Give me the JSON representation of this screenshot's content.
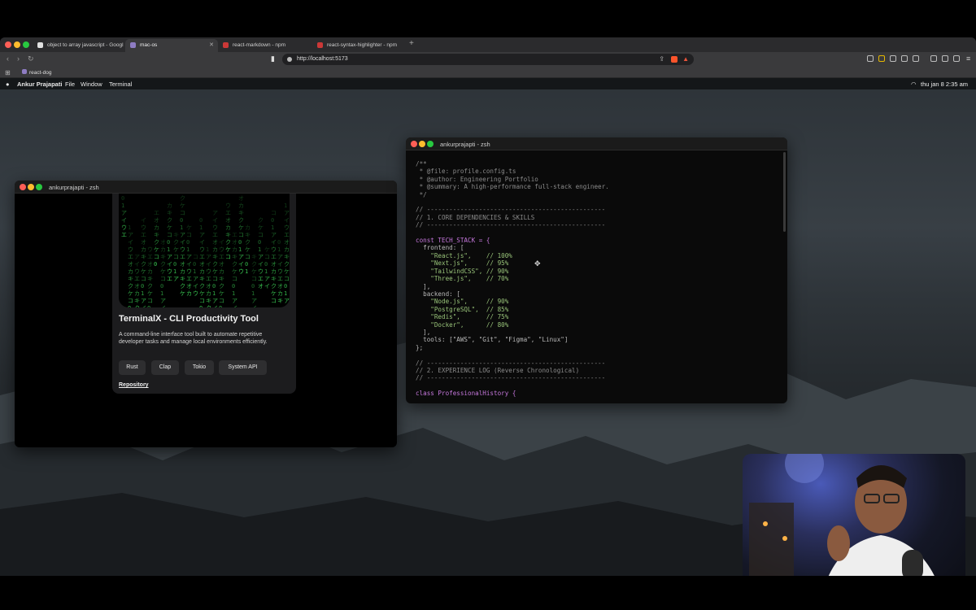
{
  "browser": {
    "tabs": [
      {
        "label": "object to array javascript - Googl",
        "active": false
      },
      {
        "label": "mac-os",
        "active": true
      },
      {
        "label": "react-markdown - npm",
        "active": false
      },
      {
        "label": "react-syntax-highlighter - npm",
        "active": false
      }
    ],
    "new_tab": "+",
    "url": "http://localhost:5173",
    "bookmark": "react-dog"
  },
  "menubar": {
    "apple": "",
    "user": "Ankur Prajapati",
    "items": [
      "File",
      "Window",
      "Terminal"
    ],
    "clock": "thu jan 8 2:35 am"
  },
  "left_window": {
    "title": "ankurprajapti - zsh",
    "card": {
      "title": "TerminalX - CLI Productivity Tool",
      "description": "A command-line interface tool built to automate repetitive developer tasks and manage local environments efficiently.",
      "tags": [
        "Rust",
        "Clap",
        "Tokio",
        "System API"
      ],
      "link": "Repository"
    }
  },
  "right_window": {
    "title": "ankurprajapti - zsh",
    "code": [
      "/**",
      " * @file: profile.config.ts",
      " * @author: Engineering Portfolio",
      " * @summary: A high-performance full-stack engineer.",
      " */",
      "",
      "// ------------------------------------------------",
      "// 1. CORE DEPENDENCIES & SKILLS",
      "// ------------------------------------------------",
      "",
      "const TECH_STACK = {",
      "  frontend: [",
      "    \"React.js\",    // 100%",
      "    \"Next.js\",     // 95%",
      "    \"TailwindCSS\", // 90%",
      "    \"Three.js\",    // 70%",
      "  ],",
      "  backend: [",
      "    \"Node.js\",     // 90%",
      "    \"PostgreSQL\",  // 85%",
      "    \"Redis\",       // 75%",
      "    \"Docker\",      // 80%",
      "  ],",
      "  tools: [\"AWS\", \"Git\", \"Figma\", \"Linux\"]",
      "};",
      "",
      "// ------------------------------------------------",
      "// 2. EXPERIENCE LOG (Reverse Chronological)",
      "// ------------------------------------------------",
      "",
      "class ProfessionalHistory {"
    ]
  },
  "dock": {
    "apps": [
      {
        "name": "github-icon",
        "color": "#111111",
        "glyph": "⌾"
      },
      {
        "name": "notes-icon",
        "color": "#f5a623",
        "glyph": "▤"
      },
      {
        "name": "pdf-icon",
        "color": "#e53935",
        "glyph": "⎘"
      },
      {
        "name": "calendar-icon",
        "color": "#6c63ff",
        "glyph": "▦"
      },
      {
        "name": "spotify-icon",
        "color": "#1db954",
        "glyph": "≋"
      },
      {
        "name": "mail-icon",
        "color": "#5c6bc0",
        "glyph": "✉"
      },
      {
        "name": "link-icon",
        "color": "#9b59b6",
        "glyph": "∞"
      },
      {
        "name": "terminal-icon",
        "color": "#111111",
        "glyph": ">_"
      }
    ]
  },
  "colors": {
    "accent_green": "#3fdc5a",
    "keyword_purple": "#c678dd",
    "string_green": "#98c379",
    "comment_gray": "#8a8a8a"
  }
}
